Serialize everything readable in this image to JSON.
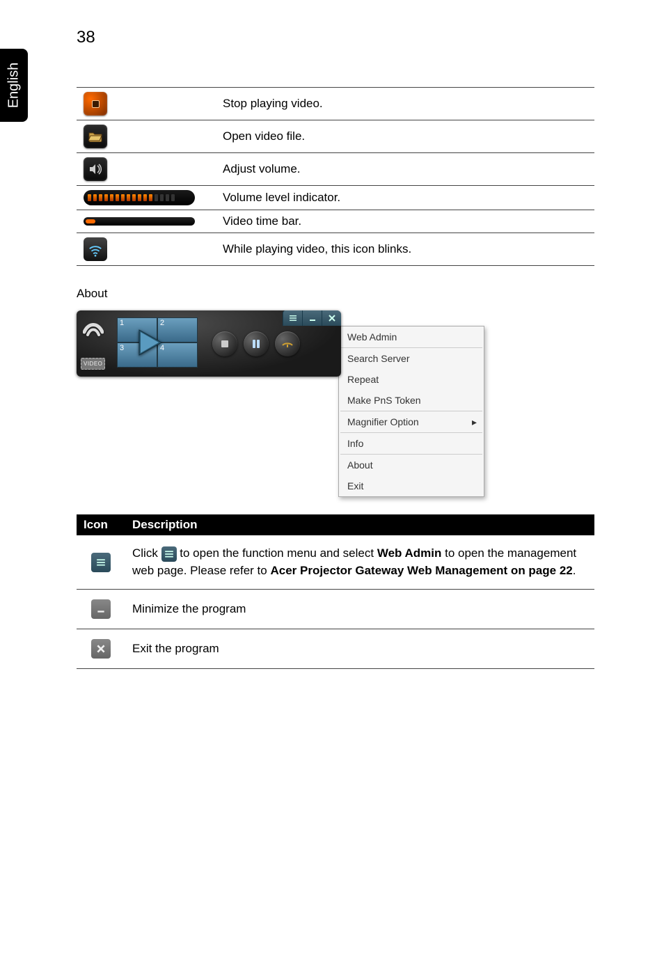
{
  "page_number": "38",
  "language_tab": "English",
  "top_table": {
    "rows": [
      "Stop playing video.",
      "Open video file.",
      "Adjust volume.",
      "Volume level indicator.",
      "Video time bar.",
      "While playing video, this icon blinks."
    ]
  },
  "section_about": "About",
  "player": {
    "video_label": "VIDEO",
    "quadrants": [
      "1",
      "2",
      "3",
      "4"
    ]
  },
  "context_menu": {
    "items": [
      "Web Admin",
      "Search Server",
      "Repeat",
      "Make PnS Token",
      "Magnifier Option",
      "Info",
      "About",
      "Exit"
    ]
  },
  "desc_table": {
    "headers": [
      "Icon",
      "Description"
    ],
    "rows": [
      {
        "parts": [
          " Click ",
          " to open the function menu and select ",
          "Web Admin",
          " to open the management web page. Please refer to ",
          "Acer Projector Gateway Web Management on page 22",
          "."
        ]
      },
      {
        "text": "Minimize the program"
      },
      {
        "text": "Exit the program"
      }
    ]
  }
}
